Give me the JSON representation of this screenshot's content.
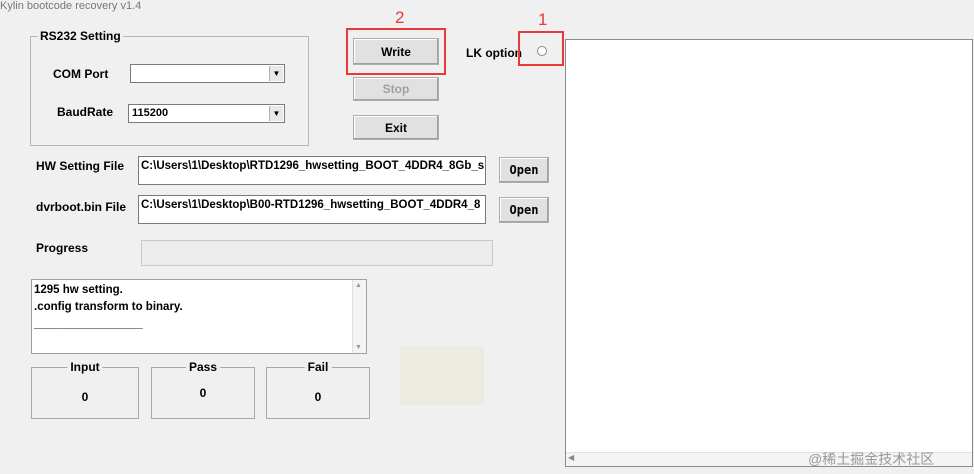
{
  "window": {
    "title": "Kylin bootcode recovery v1.4"
  },
  "rs232": {
    "group_label": "RS232 Setting",
    "com_port_label": "COM Port",
    "com_port_value": "",
    "baudrate_label": "BaudRate",
    "baudrate_value": "115200"
  },
  "buttons": {
    "write": "Write",
    "stop": "Stop",
    "exit": "Exit",
    "open": "Open"
  },
  "lk_option": {
    "label": "LK option",
    "selected": false
  },
  "hw_setting": {
    "label": "HW Setting File",
    "value": "C:\\Users\\1\\Desktop\\RTD1296_hwsetting_BOOT_4DDR4_8Gb_s"
  },
  "dvrboot": {
    "label": "dvrboot.bin File",
    "value": "C:\\Users\\1\\Desktop\\B00-RTD1296_hwsetting_BOOT_4DDR4_8"
  },
  "progress": {
    "label": "Progress",
    "value": 0
  },
  "log": {
    "lines": [
      "1295 hw setting.",
      ".config transform to binary.",
      "_________________"
    ]
  },
  "counters": [
    {
      "label": "Input",
      "value": "0"
    },
    {
      "label": "Pass",
      "value": "0"
    },
    {
      "label": "Fail",
      "value": "0"
    }
  ],
  "annotations": {
    "marker_1": "1",
    "marker_2": "2",
    "accent": "#e83a3a"
  },
  "watermark": "@稀土掘金技术社区"
}
